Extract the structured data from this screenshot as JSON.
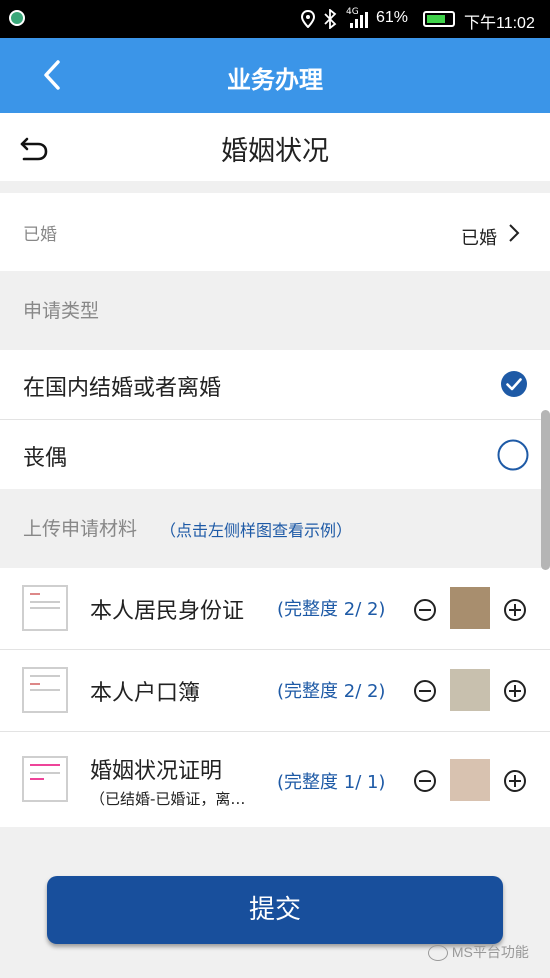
{
  "status": {
    "battery": "61%",
    "network": "4G",
    "time": "下午11:02"
  },
  "header": {
    "title": "业务办理"
  },
  "subheader": {
    "title": "婚姻状况"
  },
  "marital": {
    "label": "已婚",
    "value": "已婚"
  },
  "apply_type": {
    "heading": "申请类型",
    "options": [
      {
        "label": "在国内结婚或者离婚",
        "checked": true
      },
      {
        "label": "丧偶",
        "checked": false
      }
    ]
  },
  "upload": {
    "heading": "上传申请材料",
    "hint": "（点击左侧样图查看示例）",
    "items": [
      {
        "name": "本人居民身份证",
        "sub": "",
        "progress": "(完整度 2/ 2)"
      },
      {
        "name": "本人户口簿",
        "sub": "",
        "progress": "(完整度 2/ 2)"
      },
      {
        "name": "婚姻状况证明",
        "sub": "（已结婚-已婚证，离…",
        "progress": "(完整度 1/ 1)"
      }
    ]
  },
  "submit_label": "提交",
  "watermark": "MS平台功能",
  "colors": {
    "header": "#3b95e8",
    "submit": "#184f9c",
    "accent": "#1e5aa6"
  }
}
